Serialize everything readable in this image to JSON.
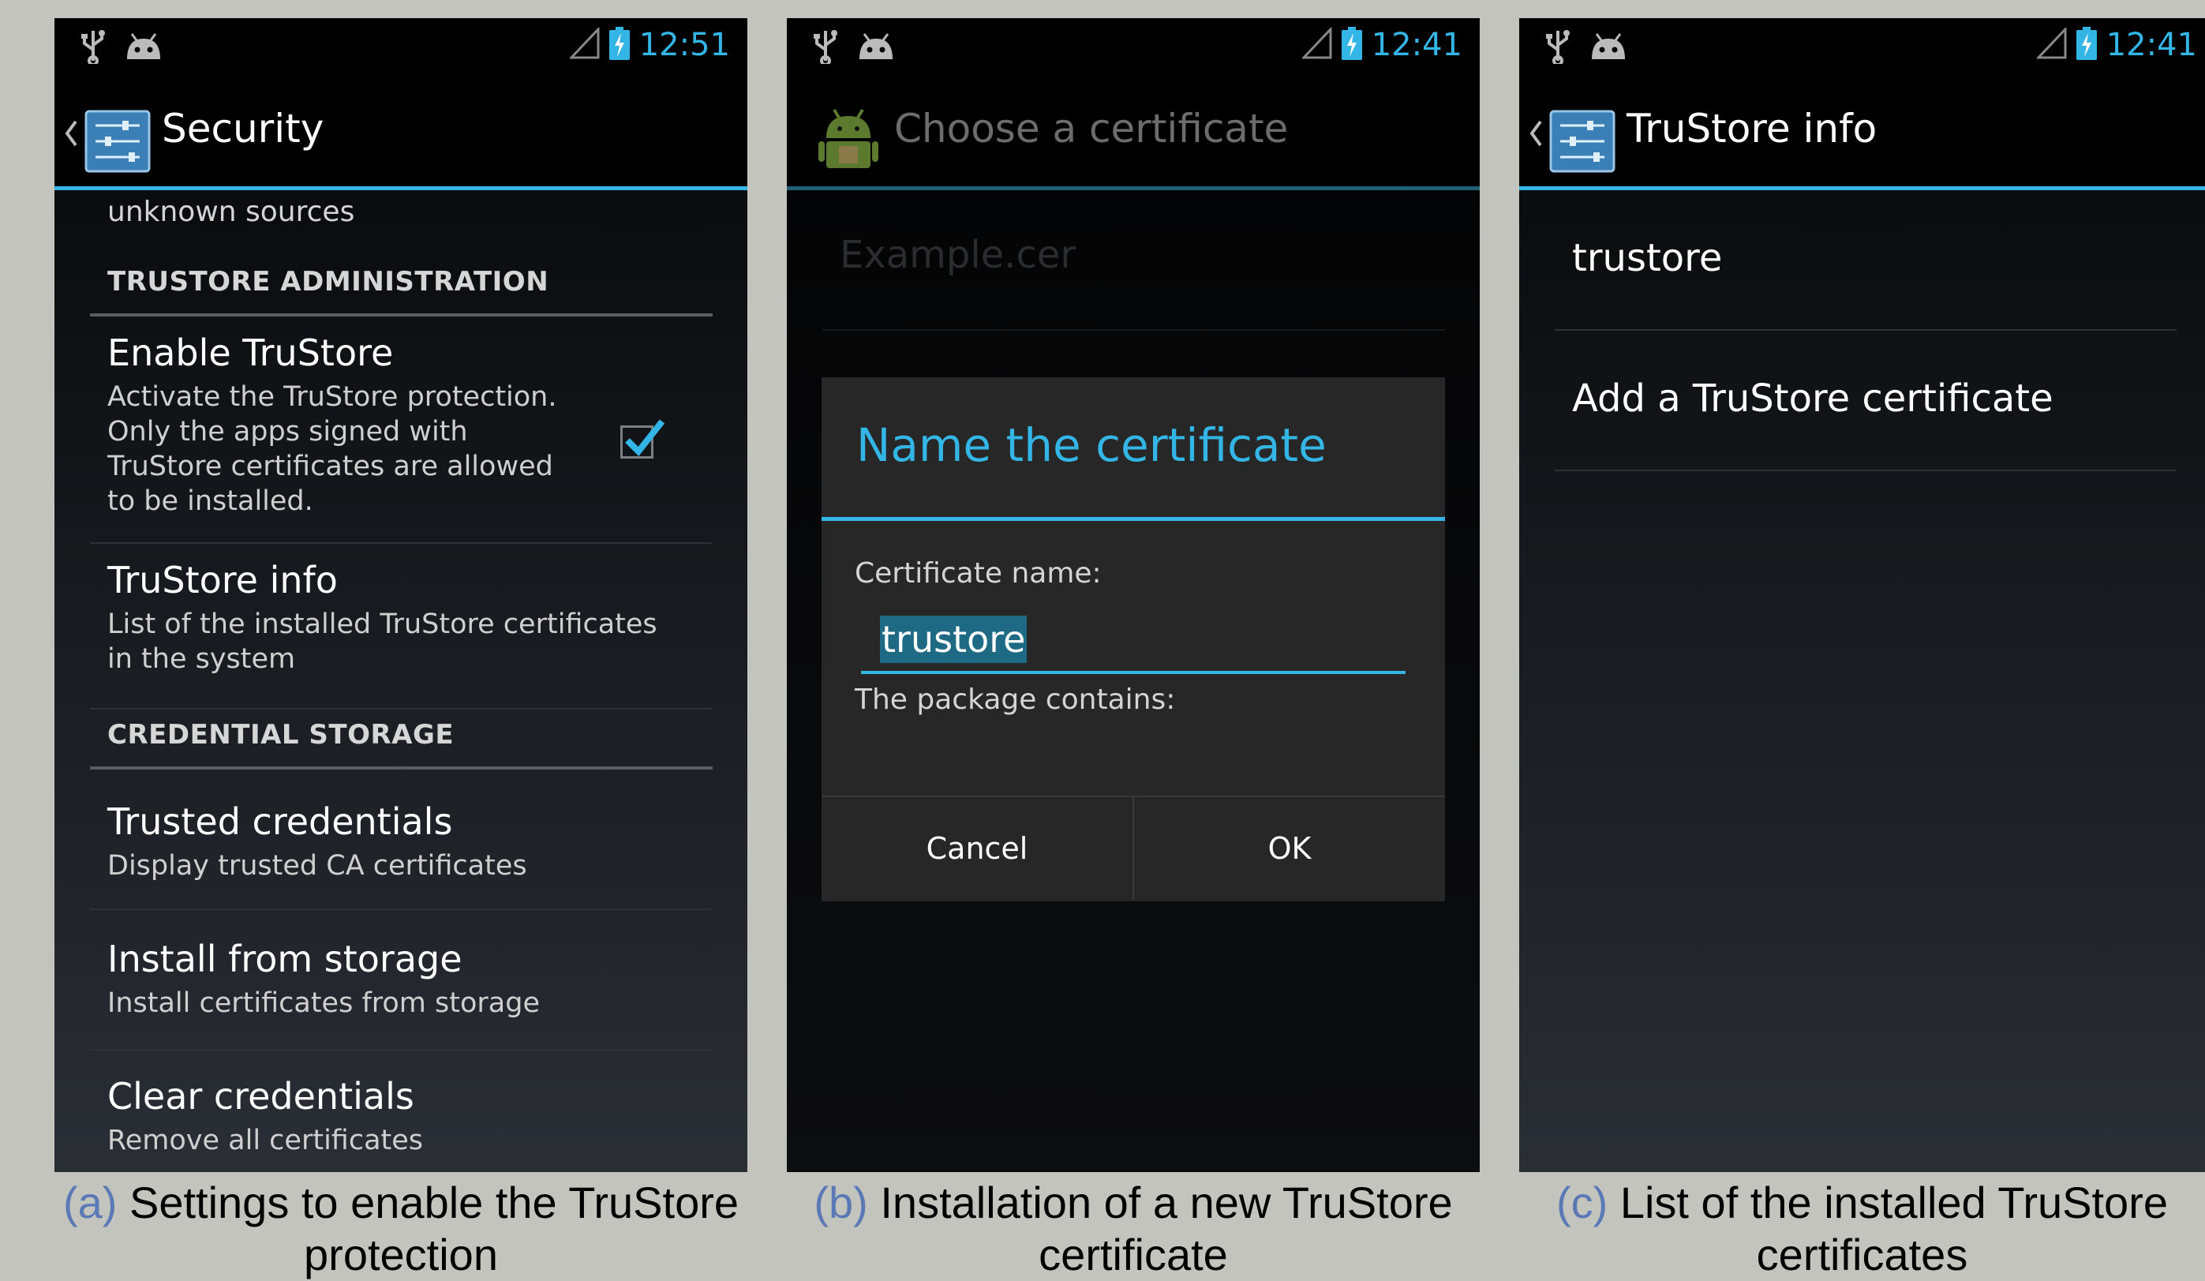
{
  "colors": {
    "accent": "#33b5e5",
    "background": "#c2c4bd",
    "caption_tag": "#5a79b5"
  },
  "panel_a": {
    "status_time": "12:51",
    "title": "Security",
    "cutoff_text": "unknown sources",
    "section_trustore": "TRUSTORE ADMINISTRATION",
    "enable_title": "Enable TruStore",
    "enable_summary": [
      "Activate the TruStore protection.",
      "Only the apps signed with",
      "TruStore certificates are allowed",
      "to be installed."
    ],
    "enable_checked": true,
    "info_title": "TruStore info",
    "info_summary": [
      "List of the installed TruStore certificates",
      "in the system"
    ],
    "section_credential": "CREDENTIAL STORAGE",
    "trusted_title": "Trusted credentials",
    "trusted_summary": "Display trusted CA certificates",
    "install_title": "Install from storage",
    "install_summary": "Install certificates from storage",
    "clear_title": "Clear credentials",
    "clear_summary": "Remove all certificates"
  },
  "panel_b": {
    "status_time": "12:41",
    "title": "Choose a certificate",
    "background_item": "Example.cer",
    "dialog": {
      "title": "Name the certificate",
      "name_label": "Certificate name:",
      "name_value": "trustore",
      "package_label": "The package contains:",
      "cancel_label": "Cancel",
      "ok_label": "OK"
    }
  },
  "panel_c": {
    "status_time": "12:41",
    "title": "TruStore info",
    "items": [
      "trustore",
      "Add a TruStore certificate"
    ]
  },
  "captions": {
    "a": {
      "tag": "(a)",
      "text": "Settings to enable the TruStore",
      "text2": "protection"
    },
    "b": {
      "tag": "(b)",
      "text": "Installation of a new TruStore",
      "text2": "certificate"
    },
    "c": {
      "tag": "(c)",
      "text": "List of the installed TruStore",
      "text2": "certificates"
    }
  },
  "icons": [
    "usb-icon",
    "android-debug-icon",
    "signal-icon",
    "battery-charging-icon",
    "back-chevron-icon",
    "settings-icon",
    "android-package-installer-icon",
    "checkbox-checked-icon"
  ]
}
